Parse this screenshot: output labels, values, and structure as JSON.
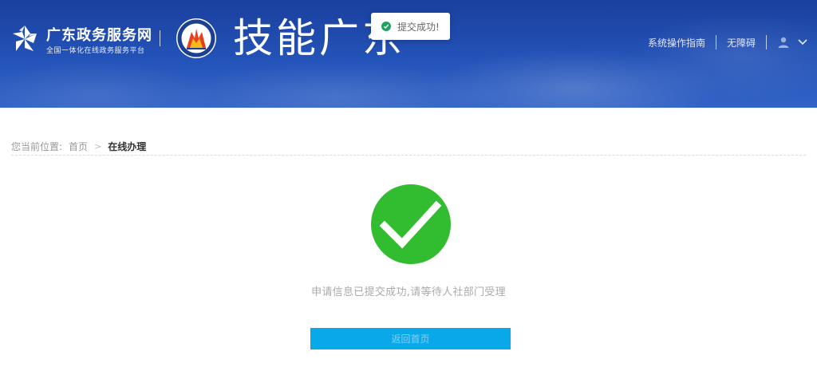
{
  "header": {
    "gov_name": "广东政务服务网",
    "gov_subtitle": "全国一体化在线政务服务平台",
    "brand_title": "技能广东",
    "nav": {
      "guide": "系统操作指南",
      "accessibility": "无障碍"
    },
    "icons": {
      "gov_logo": "pinwheel-logo-icon",
      "emblem": "skills-emblem-icon",
      "user": "user-avatar-icon",
      "dropdown": "chevron-down-icon"
    }
  },
  "toast": {
    "text": "提交成功!",
    "icon": "check-circle-icon",
    "color": "#1ea362"
  },
  "breadcrumb": {
    "prefix": "您当前位置:",
    "home": "首页",
    "separator": ">",
    "current": "在线办理"
  },
  "result": {
    "icon": "success-check-icon",
    "color": "#32bc2f",
    "message": "申请信息已提交成功,请等待人社部门受理",
    "button_label": "返回首页",
    "button_color": "#09a8e9"
  }
}
